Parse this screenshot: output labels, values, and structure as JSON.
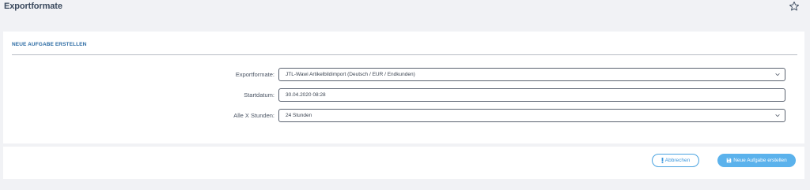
{
  "header": {
    "title": "Exportformate",
    "favorite_icon": "star-outline-icon"
  },
  "card": {
    "title": "NEUE AUFGABE ERSTELLEN",
    "fields": {
      "export_format": {
        "label": "Exportformate:",
        "value": "JTL-Wawi Artikelbildimport (Deutsch / EUR / Endkunden)",
        "icon": "chevron-down-icon"
      },
      "start_date": {
        "label": "Startdatum:",
        "value": "30.04.2020 08:28"
      },
      "interval": {
        "label": "Alle X Stunden:",
        "value": "24 Stunden",
        "icon": "chevron-down-icon"
      }
    }
  },
  "footer": {
    "cancel_label": "Abbrechen",
    "cancel_icon": "exclamation-icon",
    "create_label": "Neue Aufgabe erstellen",
    "create_icon": "save-icon"
  },
  "colors": {
    "accent": "#5bb2ec",
    "title_blue": "#2a6aa3",
    "background": "#f1f2f5"
  }
}
